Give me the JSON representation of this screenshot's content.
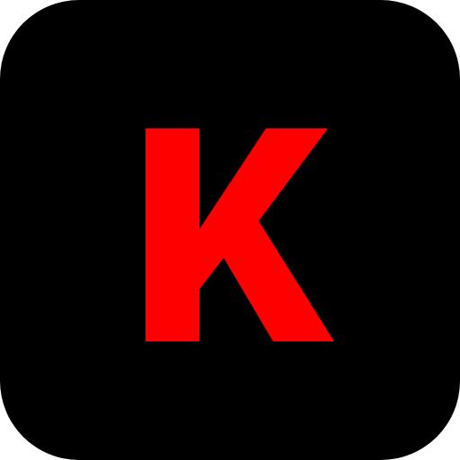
{
  "icon": {
    "letter": "K",
    "background_color": "#000000",
    "letter_color": "#ff0000"
  }
}
